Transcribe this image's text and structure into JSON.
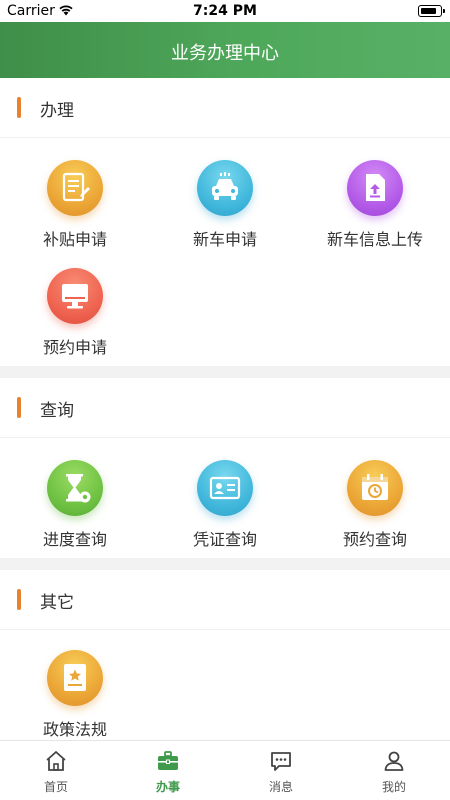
{
  "status_bar": {
    "carrier": "Carrier",
    "time": "7:24 PM"
  },
  "header": {
    "title": "业务办理中心"
  },
  "sections": [
    {
      "title": "办理",
      "items": [
        {
          "label": "补贴申请",
          "icon": "document-edit-icon",
          "color": "#eba636"
        },
        {
          "label": "新车申请",
          "icon": "car-icon",
          "color": "#42b8dc"
        },
        {
          "label": "新车信息上传",
          "icon": "file-upload-icon",
          "color": "#b45ce8"
        },
        {
          "label": "预约申请",
          "icon": "monitor-icon",
          "color": "#ef6450"
        }
      ]
    },
    {
      "title": "查询",
      "items": [
        {
          "label": "进度查询",
          "icon": "hourglass-gear-icon",
          "color": "#6fc243"
        },
        {
          "label": "凭证查询",
          "icon": "id-card-icon",
          "color": "#42b8dc"
        },
        {
          "label": "预约查询",
          "icon": "calendar-clock-icon",
          "color": "#eba636"
        }
      ]
    },
    {
      "title": "其它",
      "items": [
        {
          "label": "政策法规",
          "icon": "star-book-icon",
          "color": "#eba636"
        }
      ]
    }
  ],
  "tabbar": {
    "active": "办事",
    "tabs": [
      {
        "label": "首页",
        "icon": "home-icon"
      },
      {
        "label": "办事",
        "icon": "briefcase-icon"
      },
      {
        "label": "消息",
        "icon": "message-icon"
      },
      {
        "label": "我的",
        "icon": "user-icon"
      }
    ]
  },
  "colors": {
    "header_start": "#3f8e49",
    "header_end": "#58b066",
    "accent_bar": "#e8822f",
    "active_tab": "#3f9a4c"
  }
}
